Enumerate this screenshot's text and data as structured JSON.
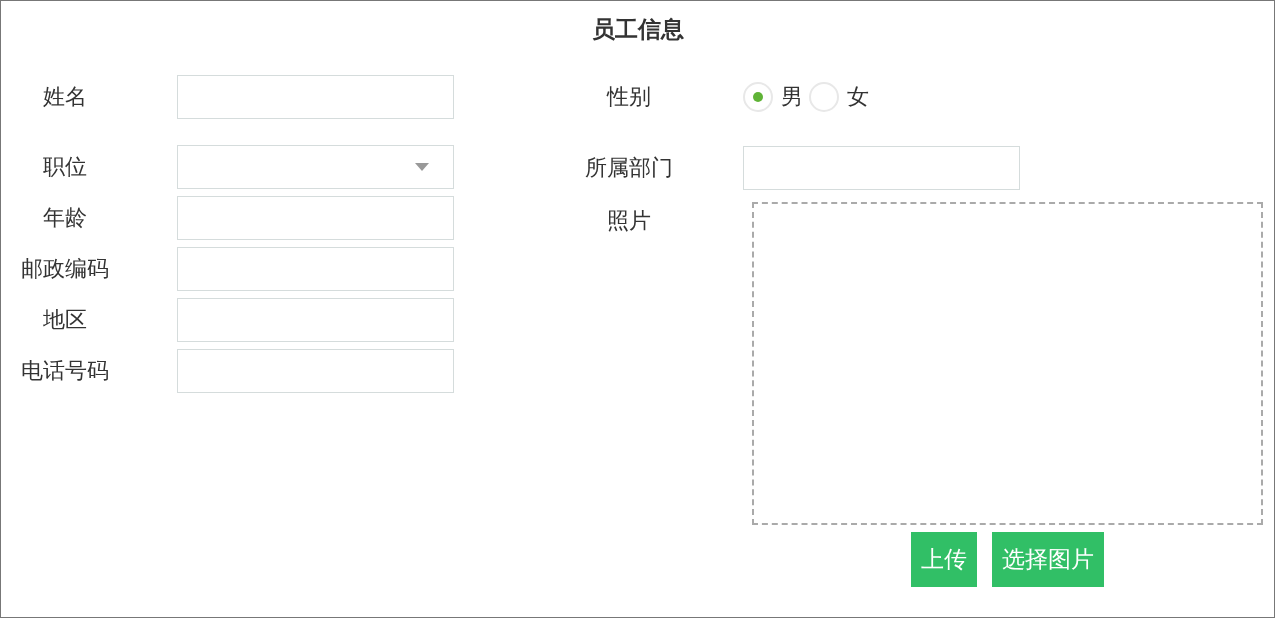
{
  "title": "员工信息",
  "left_fields": [
    {
      "label": "姓名",
      "kind": "text"
    },
    {
      "label": "职位",
      "kind": "select"
    },
    {
      "label": "年龄",
      "kind": "text"
    },
    {
      "label": "邮政编码",
      "kind": "text"
    },
    {
      "label": "地区",
      "kind": "text"
    },
    {
      "label": "电话号码",
      "kind": "text"
    }
  ],
  "gender": {
    "label": "性别",
    "options": [
      {
        "label": "男",
        "selected": true
      },
      {
        "label": "女",
        "selected": false
      }
    ]
  },
  "department": {
    "label": "所属部门"
  },
  "photo": {
    "label": "照片"
  },
  "buttons": [
    "上传",
    "选择图片"
  ]
}
